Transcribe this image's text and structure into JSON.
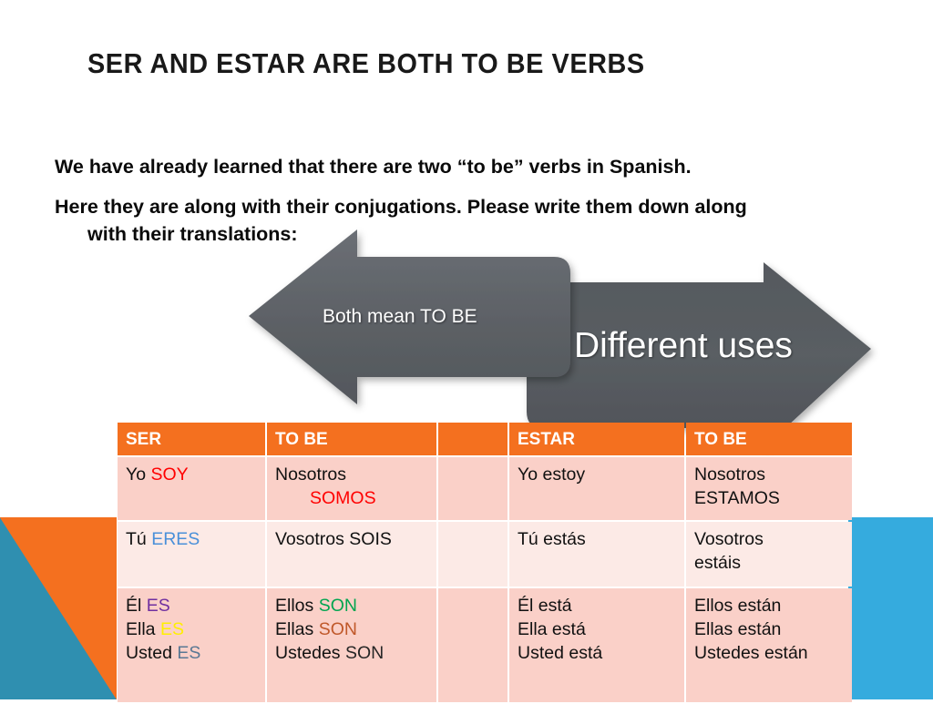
{
  "slide": {
    "title": "SER AND ESTAR ARE BOTH TO BE VERBS",
    "body": {
      "line1": "We have already learned that there are two “to be” verbs in Spanish.",
      "line2a": "Here they are along with their conjugations. Please write them down along",
      "line2b": "with their translations:"
    },
    "arrows": {
      "left_label": "Both mean TO BE",
      "right_label": "Different uses",
      "fill_color": "#5A5E63"
    },
    "colors": {
      "orange": "#F4701F",
      "teal": "#2F8FB0",
      "light_blue": "#35ABDE",
      "row_shade_a": "#FAD0C8",
      "row_shade_b": "#FCEAE6",
      "red": "#FF0000",
      "blue": "#4A90D9",
      "purple": "#7030A0",
      "yellow": "#FFF000",
      "slate": "#5A7894",
      "green": "#00A550",
      "brown": "#C0582A"
    }
  },
  "table": {
    "headers": [
      "SER",
      "TO BE",
      "",
      "ESTAR",
      "TO BE"
    ],
    "rows": [
      {
        "ser_singular": {
          "pre": "Yo ",
          "word": "SOY"
        },
        "ser_plural": {
          "line1": "Nosotros",
          "line2_word": "SOMOS"
        },
        "spacer": "",
        "estar_singular": "Yo estoy",
        "estar_plural": {
          "line1": "Nosotros",
          "line2": "ESTAMOS"
        }
      },
      {
        "ser_singular": {
          "pre": "Tú ",
          "word": "ERES"
        },
        "ser_plural": {
          "line1": "Vosotros SOIS"
        },
        "spacer": "",
        "estar_singular": "Tú estás",
        "estar_plural": {
          "line1": "Vosotros",
          "line2": "estáis"
        }
      },
      {
        "ser_singular_lines": [
          {
            "pre": "Él  ",
            "word": "ES"
          },
          {
            "pre": "Ella  ",
            "word": "ES"
          },
          {
            "pre": "Usted ",
            "word": "ES"
          }
        ],
        "ser_plural_lines": [
          {
            "pre": "Ellos ",
            "word": "SON"
          },
          {
            "pre": "Ellas ",
            "word": "SON"
          },
          {
            "pre": "Ustedes ",
            "word": "SON"
          }
        ],
        "spacer": "",
        "estar_singular_lines": [
          "Él está",
          "Ella  está",
          "Usted está"
        ],
        "estar_plural_lines": [
          "Ellos están",
          "Ellas están",
          "Ustedes están"
        ]
      }
    ]
  }
}
